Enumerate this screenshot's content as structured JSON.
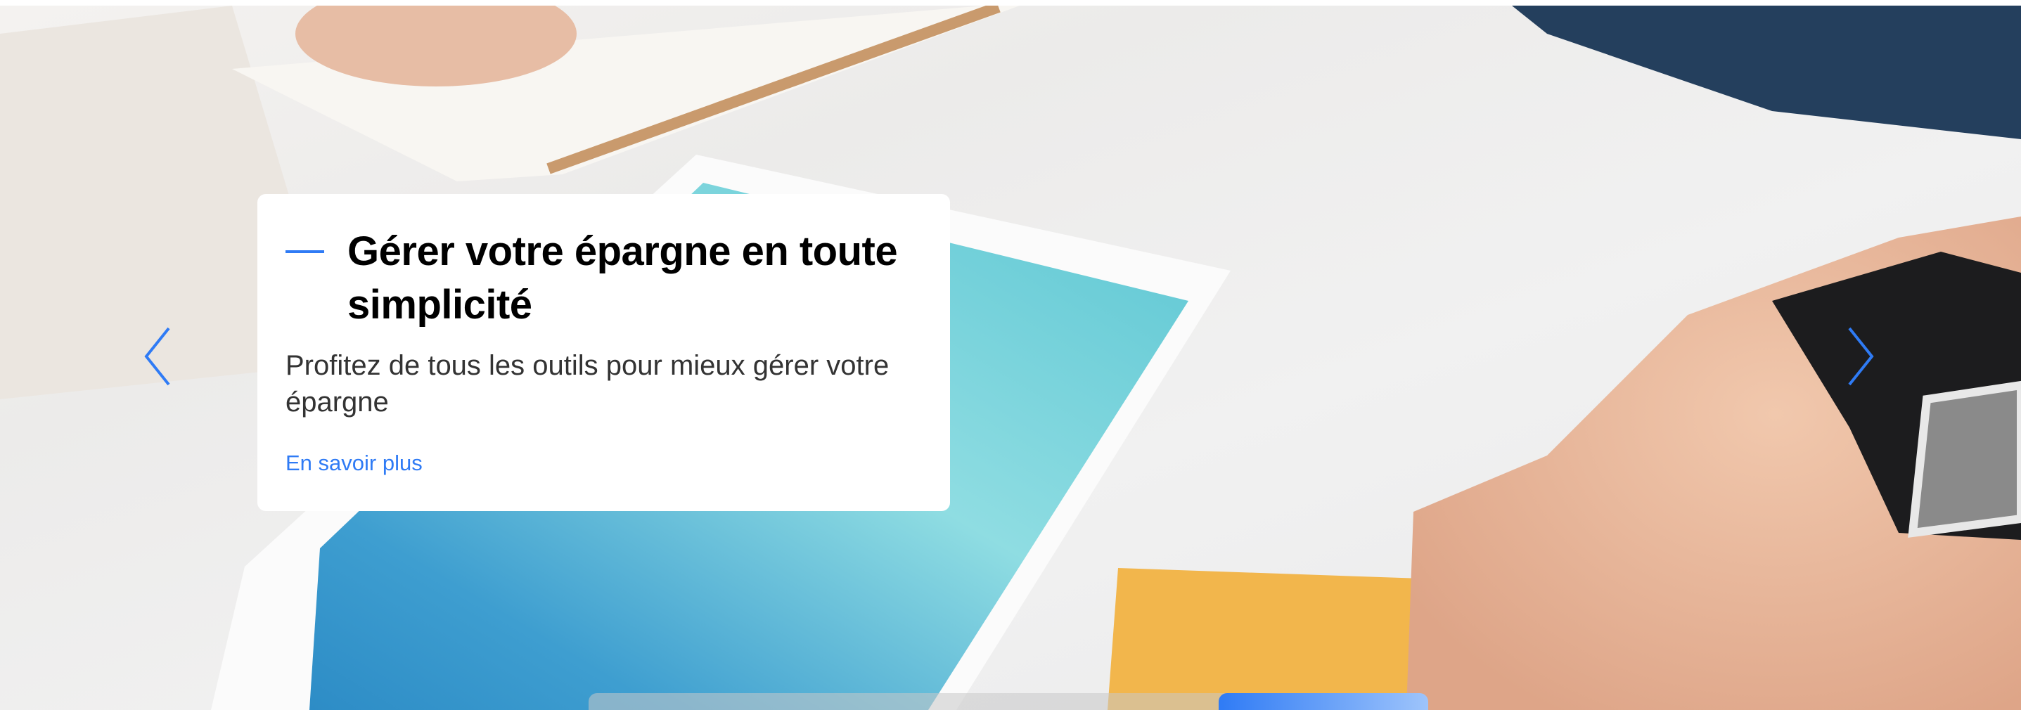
{
  "slide": {
    "title": "Gérer votre épargne en toute simplicité",
    "subtitle": "Profitez de tous les outils pour mieux gérer votre épargne",
    "link_label": "En savoir plus"
  },
  "carousel": {
    "prev_icon": "chevron-left-icon",
    "next_icon": "chevron-right-icon",
    "progress_start": 0.75,
    "progress_end": 1.0
  },
  "colors": {
    "accent": "#2f7bf5",
    "title": "#000000",
    "text": "#333333"
  }
}
